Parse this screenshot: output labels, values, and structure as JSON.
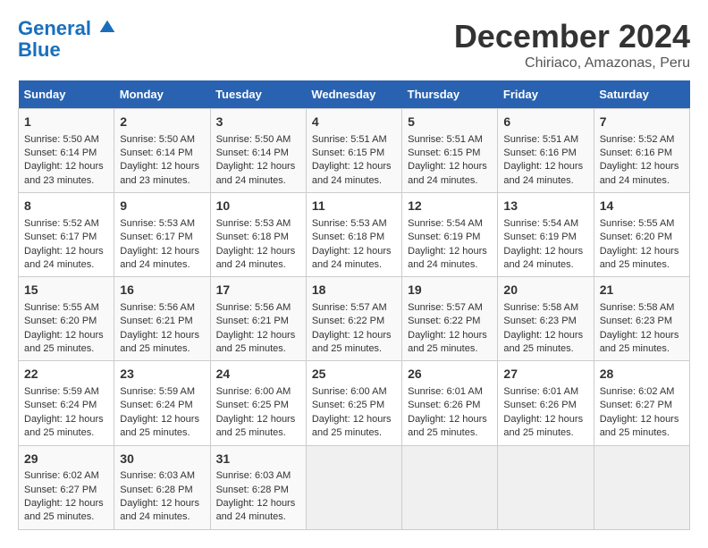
{
  "logo": {
    "line1": "General",
    "line2": "Blue"
  },
  "title": "December 2024",
  "subtitle": "Chiriaco, Amazonas, Peru",
  "days_of_week": [
    "Sunday",
    "Monday",
    "Tuesday",
    "Wednesday",
    "Thursday",
    "Friday",
    "Saturday"
  ],
  "weeks": [
    [
      {
        "day": "1",
        "info": "Sunrise: 5:50 AM\nSunset: 6:14 PM\nDaylight: 12 hours\nand 23 minutes."
      },
      {
        "day": "2",
        "info": "Sunrise: 5:50 AM\nSunset: 6:14 PM\nDaylight: 12 hours\nand 23 minutes."
      },
      {
        "day": "3",
        "info": "Sunrise: 5:50 AM\nSunset: 6:14 PM\nDaylight: 12 hours\nand 24 minutes."
      },
      {
        "day": "4",
        "info": "Sunrise: 5:51 AM\nSunset: 6:15 PM\nDaylight: 12 hours\nand 24 minutes."
      },
      {
        "day": "5",
        "info": "Sunrise: 5:51 AM\nSunset: 6:15 PM\nDaylight: 12 hours\nand 24 minutes."
      },
      {
        "day": "6",
        "info": "Sunrise: 5:51 AM\nSunset: 6:16 PM\nDaylight: 12 hours\nand 24 minutes."
      },
      {
        "day": "7",
        "info": "Sunrise: 5:52 AM\nSunset: 6:16 PM\nDaylight: 12 hours\nand 24 minutes."
      }
    ],
    [
      {
        "day": "8",
        "info": "Sunrise: 5:52 AM\nSunset: 6:17 PM\nDaylight: 12 hours\nand 24 minutes."
      },
      {
        "day": "9",
        "info": "Sunrise: 5:53 AM\nSunset: 6:17 PM\nDaylight: 12 hours\nand 24 minutes."
      },
      {
        "day": "10",
        "info": "Sunrise: 5:53 AM\nSunset: 6:18 PM\nDaylight: 12 hours\nand 24 minutes."
      },
      {
        "day": "11",
        "info": "Sunrise: 5:53 AM\nSunset: 6:18 PM\nDaylight: 12 hours\nand 24 minutes."
      },
      {
        "day": "12",
        "info": "Sunrise: 5:54 AM\nSunset: 6:19 PM\nDaylight: 12 hours\nand 24 minutes."
      },
      {
        "day": "13",
        "info": "Sunrise: 5:54 AM\nSunset: 6:19 PM\nDaylight: 12 hours\nand 24 minutes."
      },
      {
        "day": "14",
        "info": "Sunrise: 5:55 AM\nSunset: 6:20 PM\nDaylight: 12 hours\nand 25 minutes."
      }
    ],
    [
      {
        "day": "15",
        "info": "Sunrise: 5:55 AM\nSunset: 6:20 PM\nDaylight: 12 hours\nand 25 minutes."
      },
      {
        "day": "16",
        "info": "Sunrise: 5:56 AM\nSunset: 6:21 PM\nDaylight: 12 hours\nand 25 minutes."
      },
      {
        "day": "17",
        "info": "Sunrise: 5:56 AM\nSunset: 6:21 PM\nDaylight: 12 hours\nand 25 minutes."
      },
      {
        "day": "18",
        "info": "Sunrise: 5:57 AM\nSunset: 6:22 PM\nDaylight: 12 hours\nand 25 minutes."
      },
      {
        "day": "19",
        "info": "Sunrise: 5:57 AM\nSunset: 6:22 PM\nDaylight: 12 hours\nand 25 minutes."
      },
      {
        "day": "20",
        "info": "Sunrise: 5:58 AM\nSunset: 6:23 PM\nDaylight: 12 hours\nand 25 minutes."
      },
      {
        "day": "21",
        "info": "Sunrise: 5:58 AM\nSunset: 6:23 PM\nDaylight: 12 hours\nand 25 minutes."
      }
    ],
    [
      {
        "day": "22",
        "info": "Sunrise: 5:59 AM\nSunset: 6:24 PM\nDaylight: 12 hours\nand 25 minutes."
      },
      {
        "day": "23",
        "info": "Sunrise: 5:59 AM\nSunset: 6:24 PM\nDaylight: 12 hours\nand 25 minutes."
      },
      {
        "day": "24",
        "info": "Sunrise: 6:00 AM\nSunset: 6:25 PM\nDaylight: 12 hours\nand 25 minutes."
      },
      {
        "day": "25",
        "info": "Sunrise: 6:00 AM\nSunset: 6:25 PM\nDaylight: 12 hours\nand 25 minutes."
      },
      {
        "day": "26",
        "info": "Sunrise: 6:01 AM\nSunset: 6:26 PM\nDaylight: 12 hours\nand 25 minutes."
      },
      {
        "day": "27",
        "info": "Sunrise: 6:01 AM\nSunset: 6:26 PM\nDaylight: 12 hours\nand 25 minutes."
      },
      {
        "day": "28",
        "info": "Sunrise: 6:02 AM\nSunset: 6:27 PM\nDaylight: 12 hours\nand 25 minutes."
      }
    ],
    [
      {
        "day": "29",
        "info": "Sunrise: 6:02 AM\nSunset: 6:27 PM\nDaylight: 12 hours\nand 25 minutes."
      },
      {
        "day": "30",
        "info": "Sunrise: 6:03 AM\nSunset: 6:28 PM\nDaylight: 12 hours\nand 24 minutes."
      },
      {
        "day": "31",
        "info": "Sunrise: 6:03 AM\nSunset: 6:28 PM\nDaylight: 12 hours\nand 24 minutes."
      },
      {
        "day": "",
        "info": ""
      },
      {
        "day": "",
        "info": ""
      },
      {
        "day": "",
        "info": ""
      },
      {
        "day": "",
        "info": ""
      }
    ]
  ]
}
